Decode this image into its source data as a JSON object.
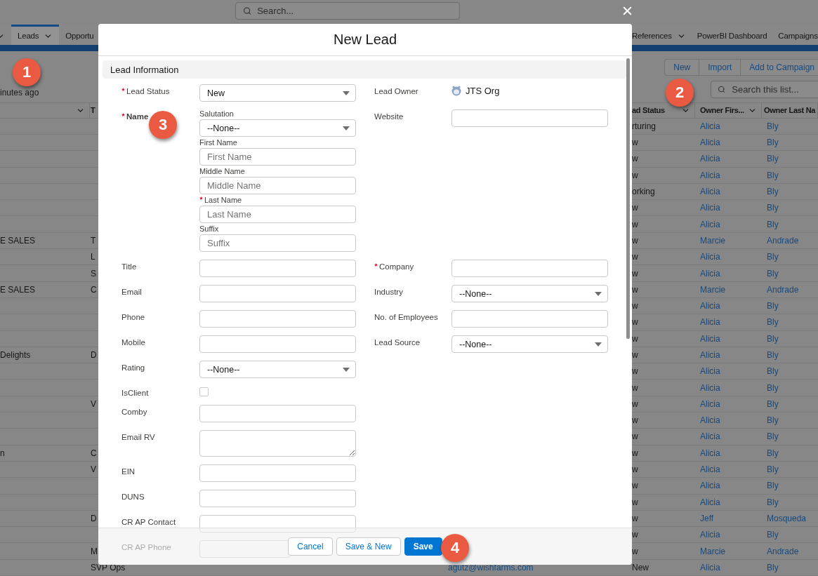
{
  "top_bar": {
    "search_placeholder": "Search..."
  },
  "nav": {
    "left_items": [
      {
        "caret": true,
        "selected": false
      },
      {
        "label": "Leads",
        "caret": true,
        "selected": true
      },
      {
        "label": "Opportu",
        "selected": false
      }
    ],
    "right_items": [
      {
        "label": "References",
        "caret": true,
        "selected": false
      },
      {
        "label": "PowerBI Dashboard",
        "selected": false
      },
      {
        "label": "Campaigns",
        "selected": false
      }
    ]
  },
  "list_header": {
    "updated": "inutes ago",
    "actions": [
      "New",
      "Import",
      "Add to Campaign"
    ],
    "search_placeholder": "Search this list..."
  },
  "table": {
    "columns": {
      "col_1": {
        "caret": true
      },
      "col_2": {
        "label": "T"
      },
      "status": {
        "label": "ad Status",
        "caret": true
      },
      "owner_first": {
        "label": "Owner Firs...",
        "caret": true
      },
      "owner_last": {
        "label": "Owner Last Na"
      }
    },
    "rows": [
      {
        "status": "rturing",
        "owner_first": "Alicia",
        "owner_last": "Bly"
      },
      {
        "status": "w",
        "owner_first": "Alicia",
        "owner_last": "Bly"
      },
      {
        "status": "w",
        "owner_first": "Alicia",
        "owner_last": "Bly"
      },
      {
        "status": "w",
        "owner_first": "Alicia",
        "owner_last": "Bly"
      },
      {
        "status": "orking",
        "owner_first": "Alicia",
        "owner_last": "Bly"
      },
      {
        "status": "w",
        "owner_first": "Alicia",
        "owner_last": "Bly"
      },
      {
        "status": "w",
        "owner_first": "Alicia",
        "owner_last": "Bly"
      },
      {
        "col_1": "E SALES",
        "col_2": "T",
        "status": "w",
        "owner_first": "Marcie",
        "owner_last": "Andrade"
      },
      {
        "col_2": "L",
        "status": "w",
        "owner_first": "Alicia",
        "owner_last": "Bly"
      },
      {
        "col_2": "S",
        "status": "w",
        "owner_first": "Alicia",
        "owner_last": "Bly"
      },
      {
        "col_1": "E SALES",
        "col_2": "C",
        "status": "w",
        "owner_first": "Marcie",
        "owner_last": "Andrade"
      },
      {
        "status": "w",
        "owner_first": "Alicia",
        "owner_last": "Bly"
      },
      {
        "status": "w",
        "owner_first": "Alicia",
        "owner_last": "Bly"
      },
      {
        "status": "w",
        "owner_first": "Alicia",
        "owner_last": "Bly"
      },
      {
        "col_1": "Delights",
        "col_2": "D",
        "status": "w",
        "owner_first": "Alicia",
        "owner_last": "Bly"
      },
      {
        "status": "w",
        "owner_first": "Alicia",
        "owner_last": "Bly"
      },
      {
        "status": "w",
        "owner_first": "Alicia",
        "owner_last": "Bly"
      },
      {
        "col_2": "V",
        "status": "w",
        "owner_first": "Alicia",
        "owner_last": "Bly"
      },
      {
        "status": "w",
        "owner_first": "Alicia",
        "owner_last": "Bly"
      },
      {
        "status": "w",
        "owner_first": "Alicia",
        "owner_last": "Bly"
      },
      {
        "col_1": "n",
        "col_2": "C",
        "status": "w",
        "owner_first": "Alicia",
        "owner_last": "Bly"
      },
      {
        "col_2": "V",
        "status": "w",
        "owner_first": "Alicia",
        "owner_last": "Bly"
      },
      {
        "status": "w",
        "owner_first": "Alicia",
        "owner_last": "Bly"
      },
      {
        "status": "w",
        "owner_first": "Alicia",
        "owner_last": "Bly"
      },
      {
        "col_2": "D",
        "status": "w",
        "owner_first": "Jeff",
        "owner_last": "Mosqueda"
      },
      {
        "status": "w",
        "owner_first": "Alicia",
        "owner_last": "Bly"
      },
      {
        "col_2": "M",
        "status": "w",
        "owner_first": "Marcie",
        "owner_last": "Andrade"
      },
      {
        "col_2": "SVP Ops",
        "email": "agutz@wishfarms.com",
        "status": "New",
        "owner_first": "Alicia",
        "owner_last": "Bly"
      }
    ]
  },
  "modal": {
    "title": "New Lead",
    "section": "Lead Information",
    "rows": [
      {
        "left": {
          "label": "Lead Status",
          "required": true,
          "kind": "select",
          "value": "New"
        },
        "right": {
          "label": "Lead Owner",
          "required": false,
          "kind": "owner",
          "value": "JTS Org"
        }
      },
      {
        "left": {
          "label": "Name",
          "required": true,
          "kind": "name",
          "parts": [
            {
              "label": "Salutation",
              "required": false,
              "kind": "select",
              "value": "--None--"
            },
            {
              "label": "First Name",
              "required": false,
              "kind": "text",
              "placeholder": "First Name"
            },
            {
              "label": "Middle Name",
              "required": false,
              "kind": "text",
              "placeholder": "Middle Name"
            },
            {
              "label": "Last Name",
              "required": true,
              "kind": "text",
              "placeholder": "Last Name"
            },
            {
              "label": "Suffix",
              "required": false,
              "kind": "text",
              "placeholder": "Suffix"
            }
          ]
        },
        "right": {
          "label": "Website",
          "required": false,
          "kind": "text"
        }
      },
      {
        "left": {
          "label": "Title",
          "required": false,
          "kind": "text"
        },
        "right": {
          "label": "Company",
          "required": true,
          "kind": "text"
        }
      },
      {
        "left": {
          "label": "Email",
          "required": false,
          "kind": "text"
        },
        "right": {
          "label": "Industry",
          "required": false,
          "kind": "select",
          "value": "--None--"
        }
      },
      {
        "left": {
          "label": "Phone",
          "required": false,
          "kind": "text"
        },
        "right": {
          "label": "No. of Employees",
          "required": false,
          "kind": "text"
        }
      },
      {
        "left": {
          "label": "Mobile",
          "required": false,
          "kind": "text"
        },
        "right": {
          "label": "Lead Source",
          "required": false,
          "kind": "select",
          "value": "--None--"
        }
      },
      {
        "left": {
          "label": "Rating",
          "required": false,
          "kind": "select",
          "value": "--None--"
        }
      },
      {
        "left": {
          "label": "IsClient",
          "required": false,
          "kind": "checkbox",
          "checked": false
        }
      },
      {
        "left": {
          "label": "Comby",
          "required": false,
          "kind": "text"
        }
      },
      {
        "left": {
          "label": "Email RV",
          "required": false,
          "kind": "textarea"
        }
      },
      {
        "left": {
          "label": "EIN",
          "required": false,
          "kind": "text"
        }
      },
      {
        "left": {
          "label": "DUNS",
          "required": false,
          "kind": "text"
        }
      },
      {
        "left": {
          "label": "CR AP Contact",
          "required": false,
          "kind": "text"
        }
      },
      {
        "left": {
          "label": "CR AP Phone",
          "required": false,
          "kind": "text"
        }
      }
    ],
    "buttons": [
      {
        "label": "Cancel",
        "kind": "neutral"
      },
      {
        "label": "Save & New",
        "kind": "neutral"
      },
      {
        "label": "Save",
        "kind": "brand"
      }
    ]
  },
  "callouts": [
    {
      "number": "1"
    },
    {
      "number": "2"
    },
    {
      "number": "3"
    },
    {
      "number": "4"
    }
  ]
}
